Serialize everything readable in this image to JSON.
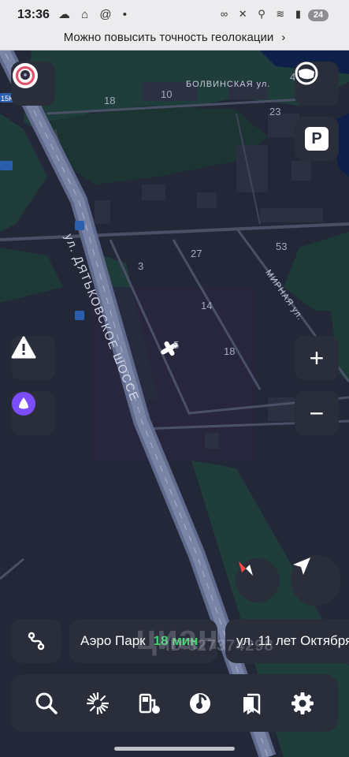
{
  "status_bar": {
    "time": "13:36",
    "left_icons": "☁ ⌂ @ •",
    "right_icons": "∞ ✕ ⚲ ≋ ▮",
    "battery": "24"
  },
  "geo_banner": {
    "text": "Можно повысить точность геолокации",
    "chevron": "›"
  },
  "map": {
    "road_badge": "15K",
    "streets": {
      "main": "ул. ДЯТЬКОВСКОЕ ШОССЕ",
      "bolvinskaya": "БОЛВИНСКАЯ ул.",
      "mirnaya": "МИРНАЯ ул."
    },
    "house_numbers": [
      "18",
      "10",
      "23",
      "4",
      "3",
      "27",
      "53",
      "14",
      "18",
      "44",
      "5"
    ],
    "transit_icon": "⬚"
  },
  "controls": {
    "plus": "+",
    "minus": "−",
    "parking": "P"
  },
  "route_bar": {
    "destination_1": "Аэро Парк",
    "time_1": "18 мин",
    "destination_2": "ул. 11 лет Октября"
  },
  "watermark": {
    "logo": "циан",
    "id": "ID 327374298"
  },
  "colors": {
    "map_bg": "#202536",
    "accent_green": "#3ed16c",
    "alice_purple": "#7c4dff"
  }
}
